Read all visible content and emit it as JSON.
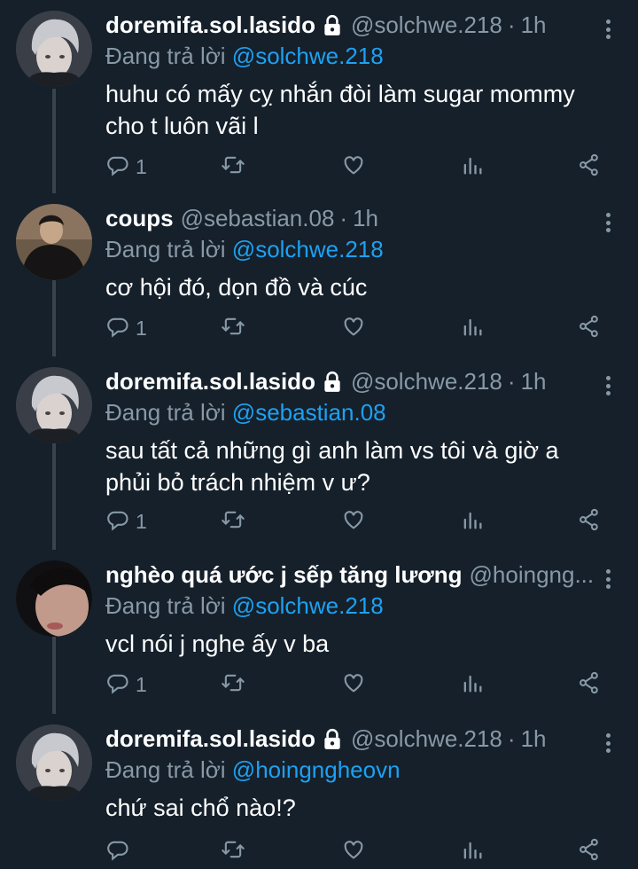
{
  "colors": {
    "background": "#15202b",
    "muted": "#8899a6",
    "link": "#1da1f2",
    "text": "#ffffff"
  },
  "reply_prefix": "Đang trả lời",
  "tweets": [
    {
      "name": "doremifa.sol.lasido",
      "locked": true,
      "handle": "@solchwe.218",
      "dot": "·",
      "time": "1h",
      "reply_to": "@solchwe.218",
      "text": "huhu có mấy cỵ nhắn đòi làm sugar mommy cho t luôn vãi l",
      "reply_count": "1",
      "avatar": "grey-hair-portrait"
    },
    {
      "name": "coups",
      "locked": false,
      "handle": "@sebastian.08",
      "dot": "·",
      "time": "1h",
      "reply_to": "@solchwe.218",
      "text": "cơ hội đó, dọn đồ và cúc",
      "reply_count": "1",
      "avatar": "dark-jacket-portrait"
    },
    {
      "name": "doremifa.sol.lasido",
      "locked": true,
      "handle": "@solchwe.218",
      "dot": "·",
      "time": "1h",
      "reply_to": "@sebastian.08",
      "text": "sau tất cả những gì anh làm vs tôi và giờ a phủi bỏ trách nhiệm v ư?",
      "reply_count": "1",
      "avatar": "grey-hair-portrait"
    },
    {
      "name": "nghèo quá ước j sếp tăng lương",
      "locked": false,
      "handle": "@hoingng...",
      "dot": "",
      "time": "",
      "reply_to": "@solchwe.218",
      "text": "vcl nói j nghe ấy v ba",
      "reply_count": "1",
      "avatar": "closeup-face-portrait"
    },
    {
      "name": "doremifa.sol.lasido",
      "locked": true,
      "handle": "@solchwe.218",
      "dot": "·",
      "time": "1h",
      "reply_to": "@hoingngheovn",
      "text": "chứ sai chổ nào!?",
      "reply_count": "",
      "avatar": "grey-hair-portrait"
    }
  ]
}
